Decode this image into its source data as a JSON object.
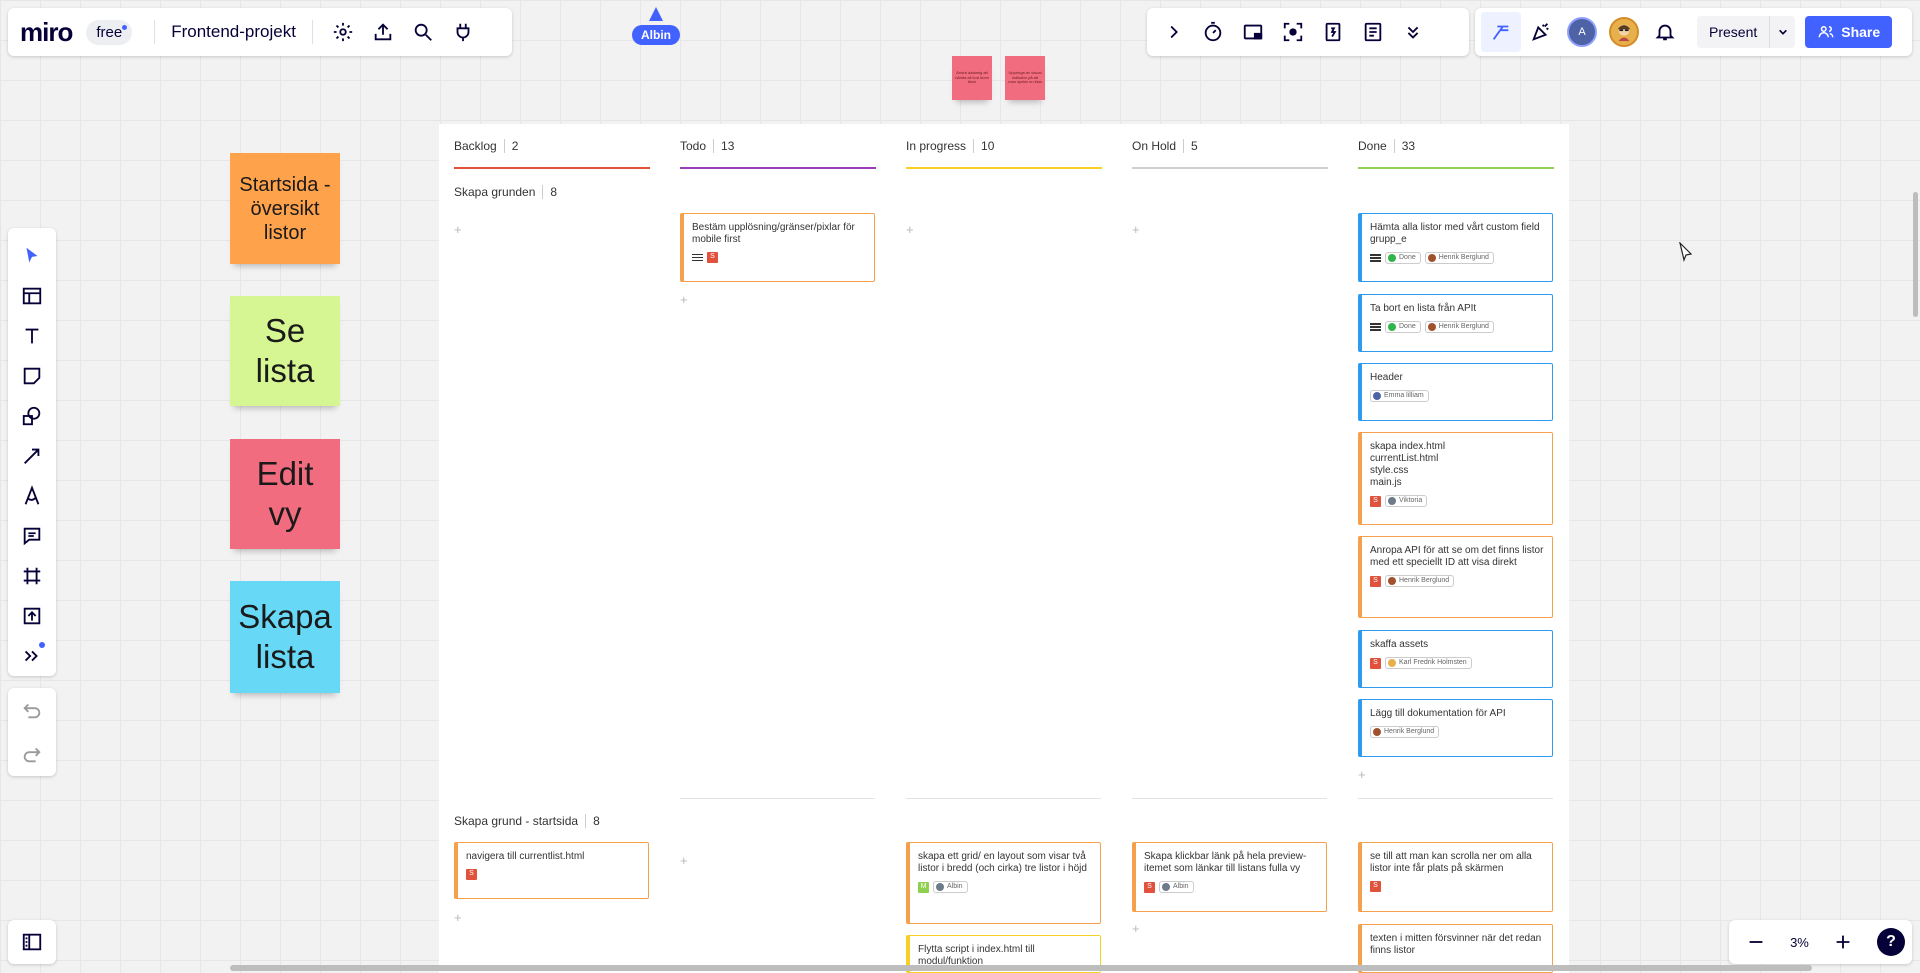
{
  "topbar": {
    "logo": "miro",
    "plan": "free",
    "board_name": "Frontend-projekt"
  },
  "toptools": {
    "icons": [
      "chevron-right-icon",
      "timer-icon",
      "card-icon",
      "focus-icon",
      "voting-icon",
      "notes-icon",
      "more-chevron-icon"
    ]
  },
  "topright": {
    "avatar_initial": "A",
    "present_label": "Present",
    "share_label": "Share"
  },
  "collaborator": {
    "name": "Albin",
    "color": "#4262ff"
  },
  "zoom": {
    "level": "3%"
  },
  "stickies": [
    {
      "text": "Startsida - översikt listor",
      "color": "#ffa24c"
    },
    {
      "text": "Se lista",
      "color": "#d5f692"
    },
    {
      "text": "Edit vy",
      "color": "#f16c7f"
    },
    {
      "text": "Skapa lista",
      "color": "#67d8f5"
    }
  ],
  "mini_stickies": [
    {
      "text": "Ändra datamig att hämta all kod inom listor",
      "color": "#f16c7f"
    },
    {
      "text": "Uppringa av visual indikator på att man spelar en lista",
      "color": "#f16c7f"
    }
  ],
  "columns": [
    {
      "name": "Backlog",
      "count": "2",
      "color": "#e0523c"
    },
    {
      "name": "Todo",
      "count": "13",
      "color": "#9b3db8"
    },
    {
      "name": "In progress",
      "count": "10",
      "color": "#f5d128"
    },
    {
      "name": "On Hold",
      "count": "5",
      "color": "#bdbdbd"
    },
    {
      "name": "Done",
      "count": "33",
      "color": "#8fd14f"
    }
  ],
  "lanes": [
    {
      "name": "Skapa grunden",
      "count": "8"
    },
    {
      "name": "Skapa grund - startsida",
      "count": "8"
    }
  ],
  "cards": {
    "todo_1": {
      "title": "Bestäm upplösning/gränser/pixlar för mobile first",
      "estimate": "S"
    },
    "done_1": {
      "title": "Hämta alla listor med vårt custom field grupp_e",
      "status": "Done",
      "assignee": "Henrik Berglund"
    },
    "done_2": {
      "title": "Ta bort en lista från APIt",
      "status": "Done",
      "assignee": "Henrik Berglund"
    },
    "done_3": {
      "title": "Header",
      "assignee": "Emma lilliam"
    },
    "done_4": {
      "title": "skapa index.html\ncurrentList.html\nstyle.css\nmain.js",
      "estimate": "S",
      "assignee": "Viktoria"
    },
    "done_5": {
      "title": "Anropa API för att se om det finns listor med ett speciellt ID att visa direkt",
      "estimate": "S",
      "assignee": "Henrik Berglund"
    },
    "done_6": {
      "title": "skaffa assets",
      "estimate": "S",
      "assignee": "Karl Fredrik Holmsten"
    },
    "done_7": {
      "title": "Lägg till dokumentation för API",
      "assignee": "Henrik Berglund"
    },
    "backlog_l2_1": {
      "title": "navigera till currentlist.html",
      "estimate": "S"
    },
    "inprog_l2_1": {
      "title": "skapa ett grid/ en layout som visar två listor i bredd (och cirka) tre listor i höjd",
      "estimate": "M",
      "assignee": "Albin"
    },
    "inprog_l2_2": {
      "title": "Flytta script i index.html till modul/funktion"
    },
    "onhold_l2_1": {
      "title": "Skapa klickbar länk på hela preview-itemet som länkar till listans fulla vy",
      "estimate": "S",
      "assignee": "Albin"
    },
    "done_l2_1": {
      "title": "se till att man kan scrolla ner om alla listor inte får plats på skärmen",
      "estimate": "S"
    },
    "done_l2_2": {
      "title": "texten i mitten försvinner när det redan finns listor"
    }
  },
  "colors": {
    "accent": "#4262ff",
    "card_orange": "#f5a04c",
    "card_blue": "#2d9bf0",
    "card_yellow": "#f5d128",
    "estimate_s": "#e0523c",
    "estimate_m": "#8fd14f"
  }
}
